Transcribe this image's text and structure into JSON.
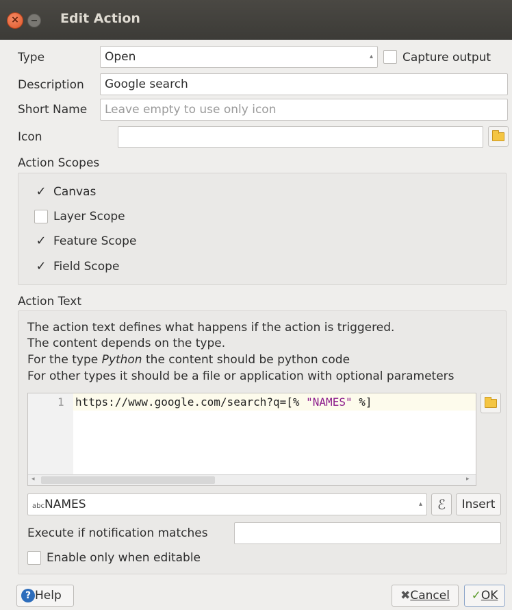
{
  "window": {
    "title": "Edit Action"
  },
  "form": {
    "type_label": "Type",
    "type_value": "Open",
    "capture_output_label": "Capture output",
    "description_label": "Description",
    "description_value": "Google search",
    "short_name_label": "Short Name",
    "short_name_placeholder": "Leave empty to use only icon",
    "icon_label": "Icon",
    "icon_value": ""
  },
  "scopes": {
    "title": "Action Scopes",
    "items": [
      {
        "label": "Canvas",
        "checked": true
      },
      {
        "label": "Layer Scope",
        "checked": false
      },
      {
        "label": "Feature Scope",
        "checked": true
      },
      {
        "label": "Field Scope",
        "checked": true
      }
    ],
    "check_glyph": "✓"
  },
  "action_text": {
    "title": "Action Text",
    "help_lines": [
      "The action text defines what happens if the action is triggered.",
      "The content depends on the type.",
      "the content should be python code",
      "For other types it should be a file or application with optional parameters"
    ],
    "help_line3_prefix": "For the type ",
    "help_line3_emph": "Python",
    "code": {
      "line_number": "1",
      "prefix": "https://www.google.com/search?q=[% ",
      "string": "\"NAMES\"",
      "suffix": " %]"
    },
    "field_combo_prefix": "abc",
    "field_combo_value": "NAMES",
    "expression_glyph": "ℰ",
    "insert_label": "Insert",
    "notification_label": "Execute if notification matches",
    "notification_value": "",
    "editable_label": "Enable only when editable"
  },
  "footer": {
    "help_label": "Help",
    "cancel_label": "Cancel",
    "ok_label": "OK"
  },
  "colors": {
    "titlebar": "#3c3b37",
    "close_button": "#e0582a",
    "code_string": "#8b1a8b",
    "line_highlight": "#fdfbec",
    "help_icon": "#2d6dbb"
  }
}
